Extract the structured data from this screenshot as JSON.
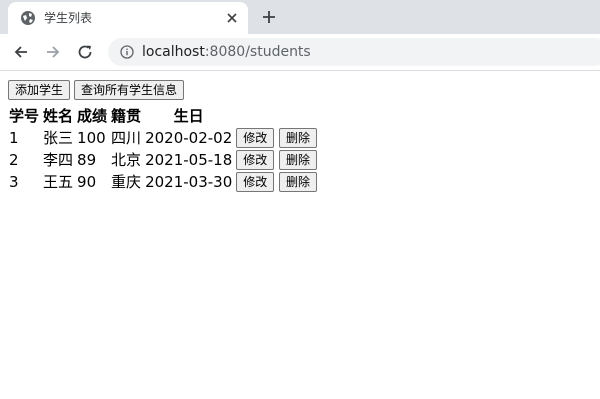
{
  "browser": {
    "tab_title": "学生列表",
    "url_host": "localhost",
    "url_rest": ":8080/students"
  },
  "page": {
    "add_button": "添加学生",
    "query_button": "查询所有学生信息",
    "columns": [
      "学号",
      "姓名",
      "成绩",
      "籍贯",
      "生日"
    ],
    "rows": [
      {
        "id": "1",
        "name": "张三",
        "score": "100",
        "hometown": "四川",
        "birthday": "2020-02-02"
      },
      {
        "id": "2",
        "name": "李四",
        "score": "89",
        "hometown": "北京",
        "birthday": "2021-05-18"
      },
      {
        "id": "3",
        "name": "王五",
        "score": "90",
        "hometown": "重庆",
        "birthday": "2021-03-30"
      }
    ],
    "edit_label": "修改",
    "delete_label": "删除"
  }
}
